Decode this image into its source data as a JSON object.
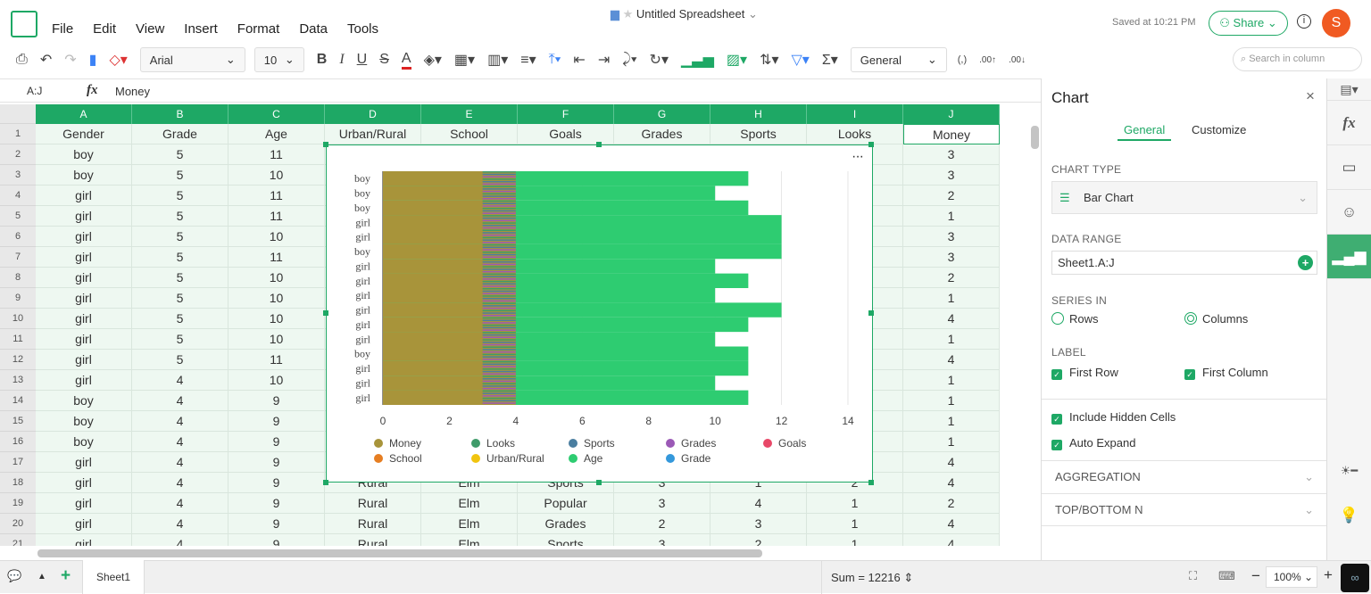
{
  "app": {
    "title": "Untitled Spreadsheet",
    "saved": "Saved at 10:21 PM",
    "share": "Share",
    "avatar": "S"
  },
  "menu": [
    "File",
    "Edit",
    "View",
    "Insert",
    "Format",
    "Data",
    "Tools"
  ],
  "toolbar": {
    "font": "Arial",
    "size": "10",
    "bold": "B",
    "italic": "I",
    "underline": "U",
    "strike": "S",
    "color": "A",
    "number_format": "General",
    "comma": "(,)",
    "search_placeholder": "Search in column"
  },
  "formula": {
    "cell_ref": "A:J",
    "fx": "fx",
    "value": "Money"
  },
  "columns": [
    "A",
    "B",
    "C",
    "D",
    "E",
    "F",
    "G",
    "H",
    "I",
    "J"
  ],
  "rows": [
    [
      "Gender",
      "Grade",
      "Age",
      "Urban/Rural",
      "School",
      "Goals",
      "Grades",
      "Sports",
      "Looks",
      "Money"
    ],
    [
      "boy",
      "5",
      "11",
      "",
      "",
      "",
      "",
      "",
      "",
      "3"
    ],
    [
      "boy",
      "5",
      "10",
      "",
      "",
      "",
      "",
      "",
      "",
      "3"
    ],
    [
      "girl",
      "5",
      "11",
      "",
      "",
      "",
      "",
      "",
      "",
      "2"
    ],
    [
      "girl",
      "5",
      "11",
      "",
      "",
      "",
      "",
      "",
      "",
      "1"
    ],
    [
      "girl",
      "5",
      "10",
      "",
      "",
      "",
      "",
      "",
      "",
      "3"
    ],
    [
      "girl",
      "5",
      "11",
      "",
      "",
      "",
      "",
      "",
      "",
      "3"
    ],
    [
      "girl",
      "5",
      "10",
      "",
      "",
      "",
      "",
      "",
      "",
      "2"
    ],
    [
      "girl",
      "5",
      "10",
      "",
      "",
      "",
      "",
      "",
      "",
      "1"
    ],
    [
      "girl",
      "5",
      "10",
      "",
      "",
      "",
      "",
      "",
      "",
      "4"
    ],
    [
      "girl",
      "5",
      "10",
      "",
      "",
      "",
      "",
      "",
      "",
      "1"
    ],
    [
      "girl",
      "5",
      "11",
      "",
      "",
      "",
      "",
      "",
      "",
      "4"
    ],
    [
      "girl",
      "4",
      "10",
      "",
      "",
      "",
      "",
      "",
      "",
      "1"
    ],
    [
      "boy",
      "4",
      "9",
      "",
      "",
      "",
      "",
      "",
      "",
      "1"
    ],
    [
      "boy",
      "4",
      "9",
      "",
      "",
      "",
      "",
      "",
      "",
      "1"
    ],
    [
      "boy",
      "4",
      "9",
      "",
      "",
      "",
      "",
      "",
      "",
      "1"
    ],
    [
      "girl",
      "4",
      "9",
      "",
      "",
      "",
      "",
      "",
      "",
      "4"
    ],
    [
      "girl",
      "4",
      "9",
      "Rural",
      "Elm",
      "Sports",
      "3",
      "1",
      "2",
      "4"
    ],
    [
      "girl",
      "4",
      "9",
      "Rural",
      "Elm",
      "Popular",
      "3",
      "4",
      "1",
      "2"
    ],
    [
      "girl",
      "4",
      "9",
      "Rural",
      "Elm",
      "Grades",
      "2",
      "3",
      "1",
      "4"
    ],
    [
      "girl",
      "4",
      "9",
      "Rural",
      "Elm",
      "Sports",
      "3",
      "2",
      "1",
      "4"
    ]
  ],
  "chart_data": {
    "type": "bar",
    "orientation": "horizontal",
    "categories": [
      "boy",
      "boy",
      "boy",
      "girl",
      "girl",
      "boy",
      "girl",
      "girl",
      "girl",
      "girl",
      "girl",
      "girl",
      "boy",
      "girl",
      "girl",
      "girl"
    ],
    "xticks": [
      "0",
      "2",
      "4",
      "6",
      "8",
      "10",
      "12",
      "14"
    ],
    "xlim": [
      0,
      14
    ],
    "grid": true,
    "legend_position": "bottom",
    "series": [
      {
        "name": "Age",
        "color": "#2ecc71",
        "values": [
          11,
          10,
          11,
          12,
          12,
          12,
          10,
          11,
          10,
          12,
          11,
          10,
          11,
          11,
          10,
          11
        ]
      },
      {
        "name": "Money",
        "color": "#a8943a",
        "values": [
          4,
          4,
          4,
          4,
          4,
          4,
          4,
          4,
          4,
          4,
          4,
          4,
          4,
          4,
          4,
          4
        ]
      }
    ],
    "legend": [
      {
        "name": "Money",
        "color": "#a8943a"
      },
      {
        "name": "Looks",
        "color": "#3f9b6a"
      },
      {
        "name": "Sports",
        "color": "#4a7ea0"
      },
      {
        "name": "Grades",
        "color": "#9b59b6"
      },
      {
        "name": "Goals",
        "color": "#e84868"
      },
      {
        "name": "School",
        "color": "#e67e22"
      },
      {
        "name": "Urban/Rural",
        "color": "#f1c40f"
      },
      {
        "name": "Age",
        "color": "#2ecc71"
      },
      {
        "name": "Grade",
        "color": "#3498db"
      }
    ]
  },
  "panel": {
    "title": "Chart",
    "tabs": [
      "General",
      "Customize"
    ],
    "chart_type_label": "CHART TYPE",
    "chart_type": "Bar Chart",
    "data_range_label": "DATA RANGE",
    "data_range": "Sheet1.A:J",
    "series_in_label": "SERIES IN",
    "rows": "Rows",
    "columns": "Columns",
    "label_label": "LABEL",
    "first_row": "First Row",
    "first_column": "First Column",
    "hidden": "Include Hidden Cells",
    "auto_expand": "Auto Expand",
    "aggregation": "AGGREGATION",
    "topn": "TOP/BOTTOM N"
  },
  "footer": {
    "sheet": "Sheet1",
    "sum": "Sum = 12216",
    "zoom": "100%"
  }
}
